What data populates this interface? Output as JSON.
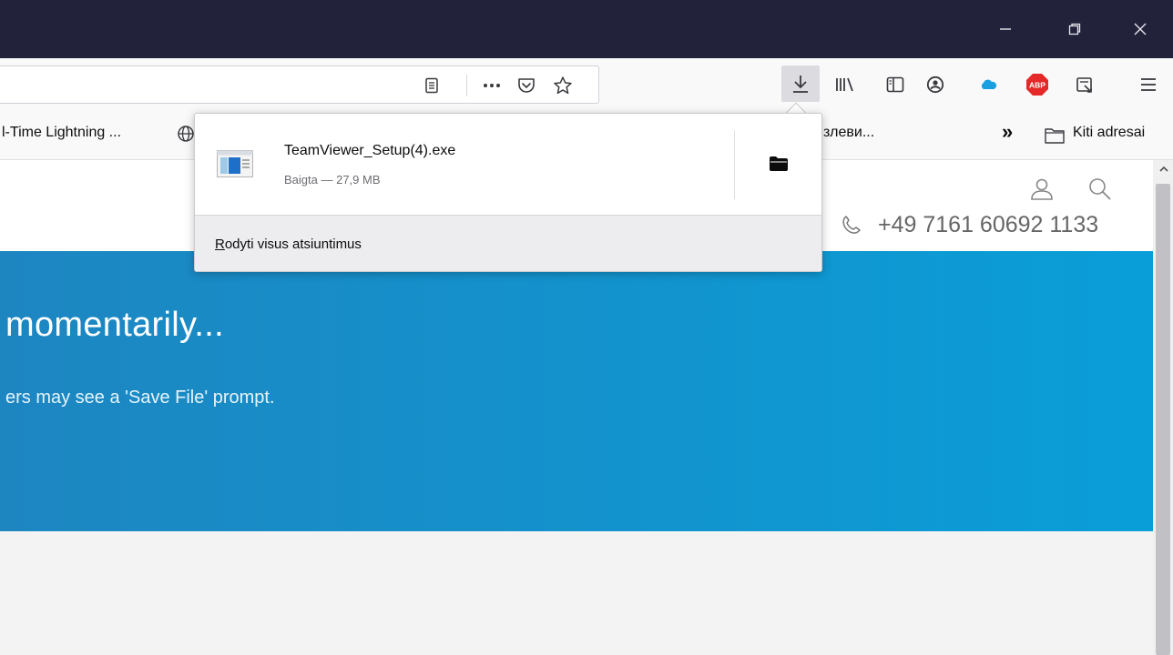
{
  "window": {
    "controls": [
      {
        "name": "minimize-icon"
      },
      {
        "name": "restore-icon"
      },
      {
        "name": "close-icon"
      }
    ]
  },
  "toolbar": {
    "url_icons": [
      "reader-view-icon",
      "page-actions-icon",
      "pocket-icon",
      "bookmark-star-icon"
    ],
    "right_icons": [
      "downloads-icon",
      "library-icon",
      "sidebar-icon",
      "account-icon",
      "cloud-extension-icon",
      "adblock-plus-icon",
      "screenshot-extension-icon",
      "menu-icon"
    ],
    "adblock_label": "ABP",
    "downloads_active": true
  },
  "bookmarks": {
    "items": [
      {
        "label": "l-Time Lightning ..."
      },
      {
        "label": "злеви..."
      }
    ],
    "overflow_label": "»",
    "other_folder_label": "Kiti adresai"
  },
  "downloads_panel": {
    "item": {
      "file_name": "TeamViewer_Setup(4).exe",
      "status": "Baigta — 27,9 MB",
      "icon": "exe-file-icon",
      "action_icon": "folder-icon"
    },
    "footer_label": "Rodyti visus atsiuntimus"
  },
  "page": {
    "phone": "+49 7161 60692 1133",
    "hero_title": "momentarily...",
    "hero_subtitle": "ers may see a 'Save File' prompt.",
    "hero_color": "#0a9ed8"
  }
}
